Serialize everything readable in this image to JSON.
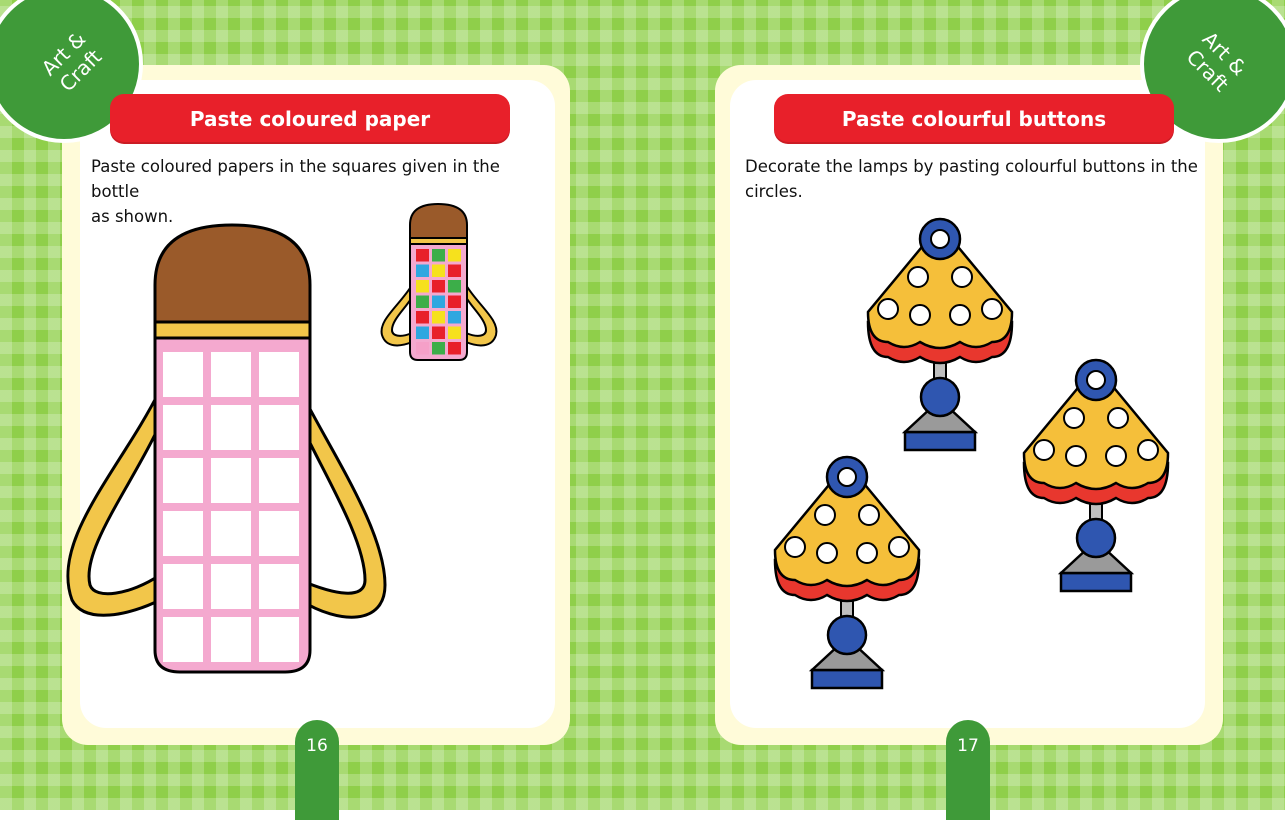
{
  "badge": {
    "label_line1": "Art &",
    "label_line2": "Craft"
  },
  "left_page": {
    "title": "Paste coloured paper",
    "instruction_line1": "Paste coloured papers in the squares given in the bottle",
    "instruction_line2": "as shown.",
    "page_number": "16"
  },
  "right_page": {
    "title": "Paste colourful buttons",
    "instruction_line1": "Decorate the lamps by pasting colourful buttons in the",
    "instruction_line2": "circles.",
    "page_number": "17"
  },
  "colors": {
    "background_green": "#8fcf4a",
    "badge_green": "#3f9a39",
    "title_red": "#e8202a",
    "cap_brown": "#9a5a2a",
    "strap_yellow": "#f2c64a",
    "bottle_pink": "#f4a9cf",
    "lamp_shade_yellow": "#f5bf3a",
    "lamp_shade_red": "#e8372e",
    "lamp_blue": "#2f56b0",
    "lamp_grey": "#9a9a9a"
  },
  "sample_bottle_grid_colors": [
    [
      "#e8202a",
      "#3cae49",
      "#f6e11d"
    ],
    [
      "#2fa7e0",
      "#f6e11d",
      "#e8202a"
    ],
    [
      "#f6e11d",
      "#e8202a",
      "#3cae49"
    ],
    [
      "#3cae49",
      "#2fa7e0",
      "#e8202a"
    ],
    [
      "#e8202a",
      "#f6e11d",
      "#2fa7e0"
    ],
    [
      "#2fa7e0",
      "#e8202a",
      "#f6e11d"
    ],
    [
      "#f5a0c8",
      "#3cae49",
      "#e8202a"
    ]
  ]
}
